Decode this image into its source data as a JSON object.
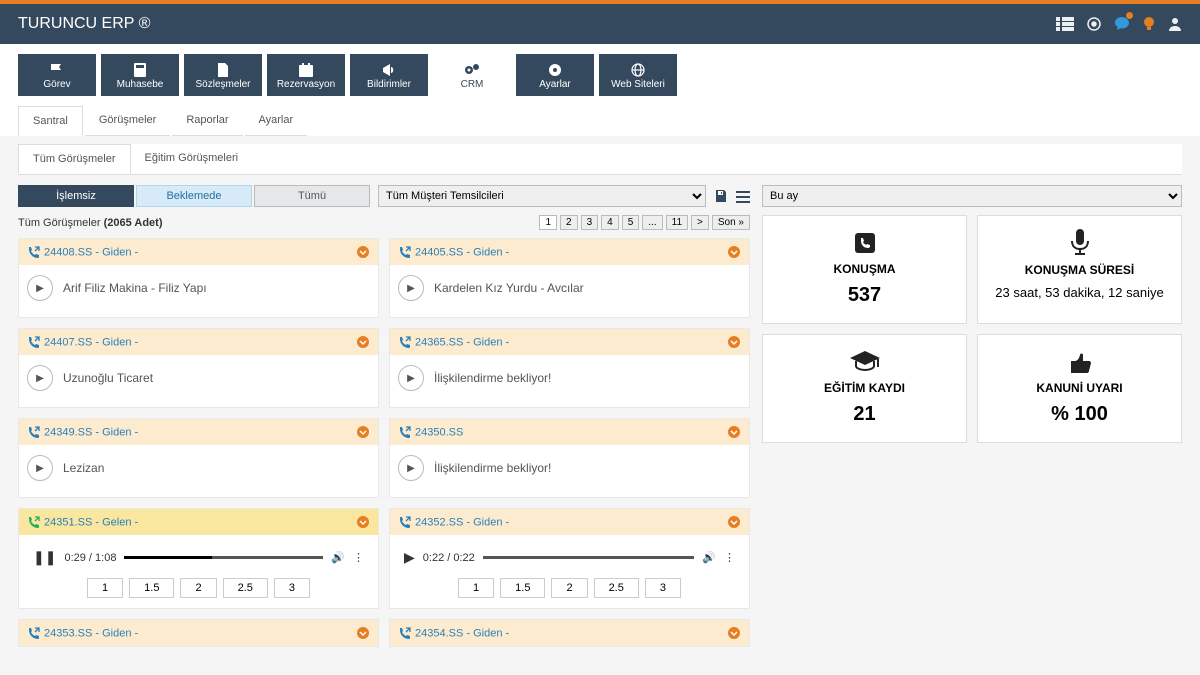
{
  "app_title": "TURUNCU ERP ®",
  "nav": [
    {
      "label": "Görev",
      "icon": "flag"
    },
    {
      "label": "Muhasebe",
      "icon": "calc"
    },
    {
      "label": "Sözleşmeler",
      "icon": "doc"
    },
    {
      "label": "Rezervasyon",
      "icon": "cal"
    },
    {
      "label": "Bildirimler",
      "icon": "bull"
    },
    {
      "label": "CRM",
      "icon": "gears",
      "active": true
    },
    {
      "label": "Ayarlar",
      "icon": "gear"
    },
    {
      "label": "Web Siteleri",
      "icon": "globe"
    }
  ],
  "tabs": [
    "Santral",
    "Görüşmeler",
    "Raporlar",
    "Ayarlar"
  ],
  "active_tab": "Santral",
  "subtabs": [
    "Tüm Görüşmeler",
    "Eğitim Görüşmeleri"
  ],
  "active_subtab": "Tüm Görüşmeler",
  "filters": {
    "buttons": [
      {
        "label": "İşlemsiz",
        "style": "darkblue"
      },
      {
        "label": "Beklemede",
        "style": "lightblue"
      },
      {
        "label": "Tümü",
        "style": "gray"
      }
    ],
    "rep_select": "Tüm Müşteri Temsilcileri",
    "period_select": "Bu ay"
  },
  "count": {
    "prefix": "Tüm Görüşmeler",
    "bold": "(2065 Adet)"
  },
  "pager": [
    "1",
    "2",
    "3",
    "4",
    "5",
    "...",
    "11",
    ">",
    "Son »"
  ],
  "pager_active": "1",
  "calls_left": [
    {
      "id": "24408.SS",
      "dir": "Giden",
      "body": "Arif Filiz Makina - Filiz Yapı",
      "type": "simple"
    },
    {
      "id": "24407.SS",
      "dir": "Giden",
      "body": "Uzunoğlu Ticaret",
      "type": "simple"
    },
    {
      "id": "24349.SS",
      "dir": "Giden",
      "body": "Lezizan",
      "type": "simple"
    },
    {
      "id": "24351.SS",
      "dir": "Gelen",
      "type": "audio",
      "playing": true,
      "cur": "0:29",
      "dur": "1:08",
      "prog": 44
    },
    {
      "id": "24353.SS",
      "dir": "Giden",
      "type": "headonly"
    }
  ],
  "calls_right": [
    {
      "id": "24405.SS",
      "dir": "Giden",
      "body": "Kardelen Kız Yurdu - Avcılar",
      "type": "simple"
    },
    {
      "id": "24365.SS",
      "dir": "Giden",
      "body": "İlişkilendirme bekliyor!",
      "type": "simple"
    },
    {
      "id": "24350.SS",
      "dir": "",
      "body": "İlişkilendirme bekliyor!",
      "type": "simple"
    },
    {
      "id": "24352.SS",
      "dir": "Giden",
      "type": "audio",
      "playing": false,
      "cur": "0:22",
      "dur": "0:22",
      "prog": 0
    },
    {
      "id": "24354.SS",
      "dir": "Giden",
      "type": "headonly"
    }
  ],
  "speeds": [
    "1",
    "1.5",
    "2",
    "2.5",
    "3"
  ],
  "stats": [
    {
      "icon": "phone",
      "label": "KONUŞMA",
      "val": "537",
      "big": true
    },
    {
      "icon": "mic",
      "label": "KONUŞMA SÜRESİ",
      "val": "23 saat, 53 dakika, 12 saniye",
      "big": false
    },
    {
      "icon": "grad",
      "label": "EĞİTİM KAYDI",
      "val": "21",
      "big": true
    },
    {
      "icon": "thumb",
      "label": "KANUNİ UYARI",
      "val": "% 100",
      "big": true
    }
  ]
}
